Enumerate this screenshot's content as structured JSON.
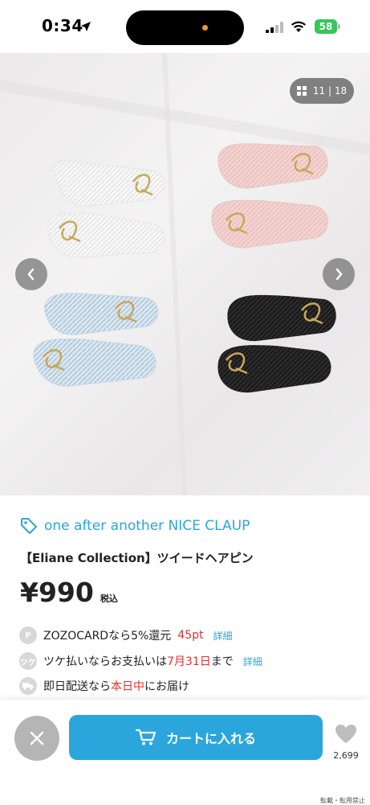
{
  "status_bar": {
    "time": "0:34",
    "battery": "58"
  },
  "gallery": {
    "counter": "11 | 18"
  },
  "product": {
    "brand": "one after another NICE CLAUP",
    "title": "【Eliane Collection】ツイードヘアピン",
    "price": "¥990",
    "tax_label": "税込"
  },
  "info": {
    "points": {
      "text": "ZOZOCARDなら5%還元",
      "highlight": "45pt",
      "link": "詳細"
    },
    "tsuke": {
      "text_before": "ツケ払いならお支払いは",
      "highlight": "7月31日",
      "text_after": "まで",
      "link": "詳細"
    },
    "delivery": {
      "text_before": "即日配送なら",
      "highlight": "本日中",
      "text_after": "にお届け"
    }
  },
  "actions": {
    "cart_label": "カートに入れる",
    "favorite_count": "2,699"
  },
  "footer": {
    "note": "転載・転用禁止"
  },
  "colors": {
    "accent": "#2aa6dd",
    "highlight": "#e0322f"
  }
}
